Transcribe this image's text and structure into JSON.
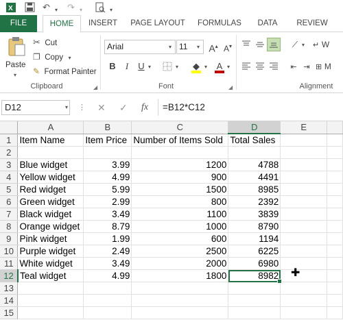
{
  "qat": {
    "excel_icon": "excel-logo-icon",
    "save_icon": "save-icon",
    "undo_icon": "undo-icon",
    "redo_icon": "redo-icon",
    "preview_icon": "print-preview-icon"
  },
  "tabs": [
    "FILE",
    "HOME",
    "INSERT",
    "PAGE LAYOUT",
    "FORMULAS",
    "DATA",
    "REVIEW"
  ],
  "ribbon": {
    "clipboard": {
      "paste": "Paste",
      "cut": "Cut",
      "copy": "Copy",
      "format_painter": "Format Painter",
      "label": "Clipboard"
    },
    "font": {
      "name": "Arial",
      "size": "11",
      "grow": "A",
      "shrink": "A",
      "bold": "B",
      "italic": "I",
      "underline": "U",
      "font_color": "A",
      "label": "Font"
    },
    "alignment": {
      "label": "Alignment",
      "wrap": "W",
      "merge": "M"
    }
  },
  "formula_bar": {
    "name_box": "D12",
    "formula": "=B12*C12",
    "fx": "fx"
  },
  "sheet": {
    "columns": [
      "A",
      "B",
      "C",
      "D",
      "E"
    ],
    "selected_column": "D",
    "selected_row": 12,
    "rows": [
      {
        "n": "1",
        "cells": [
          "Item Name",
          "Item Price",
          "Number of Items Sold",
          "Total Sales",
          ""
        ]
      },
      {
        "n": "2",
        "cells": [
          "",
          "",
          "",
          "",
          ""
        ]
      },
      {
        "n": "3",
        "cells": [
          "Blue widget",
          "3.99",
          "1200",
          "4788",
          ""
        ]
      },
      {
        "n": "4",
        "cells": [
          "Yellow widget",
          "4.99",
          "900",
          "4491",
          ""
        ]
      },
      {
        "n": "5",
        "cells": [
          "Red widget",
          "5.99",
          "1500",
          "8985",
          ""
        ]
      },
      {
        "n": "6",
        "cells": [
          "Green widget",
          "2.99",
          "800",
          "2392",
          ""
        ]
      },
      {
        "n": "7",
        "cells": [
          "Black widget",
          "3.49",
          "1100",
          "3839",
          ""
        ]
      },
      {
        "n": "8",
        "cells": [
          "Orange widget",
          "8.79",
          "1000",
          "8790",
          ""
        ]
      },
      {
        "n": "9",
        "cells": [
          "Pink widget",
          "1.99",
          "600",
          "1194",
          ""
        ]
      },
      {
        "n": "10",
        "cells": [
          "Purple widget",
          "2.49",
          "2500",
          "6225",
          ""
        ]
      },
      {
        "n": "11",
        "cells": [
          "White widget",
          "3.49",
          "2000",
          "6980",
          ""
        ]
      },
      {
        "n": "12",
        "cells": [
          "Teal widget",
          "4.99",
          "1800",
          "8982",
          ""
        ]
      },
      {
        "n": "13",
        "cells": [
          "",
          "",
          "",
          "",
          ""
        ]
      },
      {
        "n": "14",
        "cells": [
          "",
          "",
          "",
          "",
          ""
        ]
      },
      {
        "n": "15",
        "cells": [
          "",
          "",
          "",
          "",
          ""
        ]
      }
    ]
  },
  "colors": {
    "accent": "#217346",
    "font_color_bar": "#c00000",
    "highlight_bar": "#ffff00"
  }
}
